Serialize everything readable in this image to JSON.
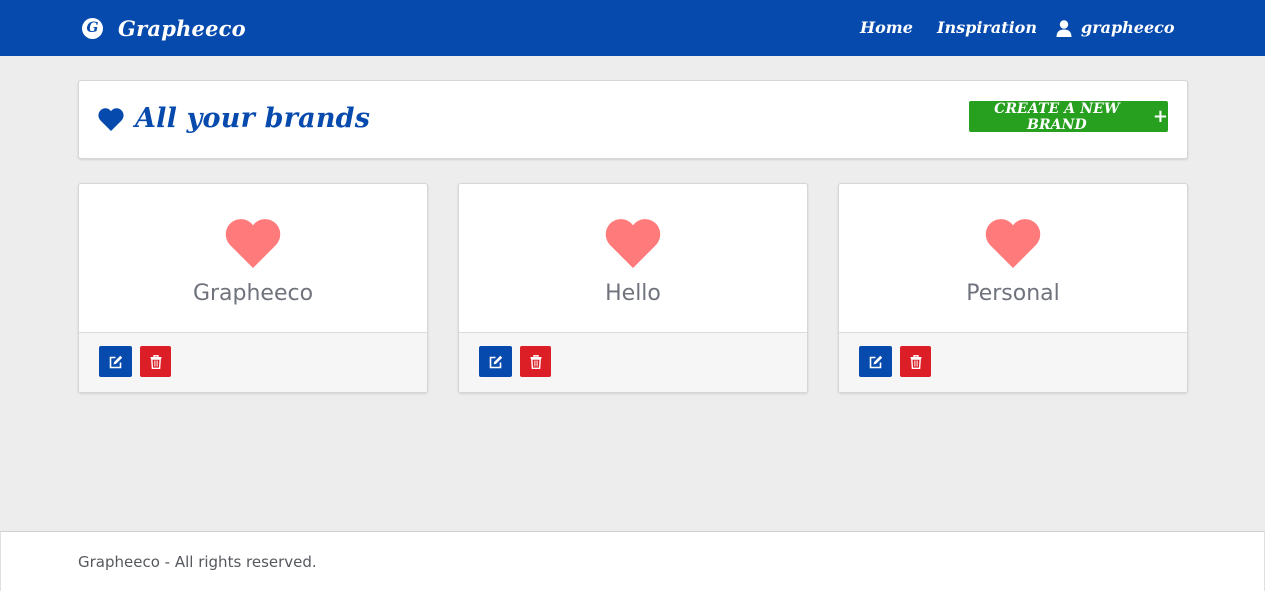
{
  "navbar": {
    "logo_letter": "G",
    "brand_name": "Grapheeco",
    "links": [
      {
        "label": "Home"
      },
      {
        "label": "Inspiration"
      }
    ],
    "user": {
      "name": "grapheeco",
      "icon": "user-icon"
    },
    "background_color": "#074aad"
  },
  "header": {
    "icon": "heart-icon",
    "title": "All your brands",
    "create_button_label": "CREATE A NEW BRAND",
    "create_button_icon": "plus-icon",
    "create_button_color": "#27a01f"
  },
  "brands": [
    {
      "name": "Grapheeco",
      "icon": "heart-icon",
      "edit_icon": "edit-icon",
      "delete_icon": "trash-icon"
    },
    {
      "name": "Hello",
      "icon": "heart-icon",
      "edit_icon": "edit-icon",
      "delete_icon": "trash-icon"
    },
    {
      "name": "Personal",
      "icon": "heart-icon",
      "edit_icon": "edit-icon",
      "delete_icon": "trash-icon"
    }
  ],
  "colors": {
    "heart": "#ff7b7b",
    "edit_button": "#074aad",
    "delete_button": "#dc1f26"
  },
  "footer": {
    "text": "Grapheeco - All rights reserved."
  }
}
